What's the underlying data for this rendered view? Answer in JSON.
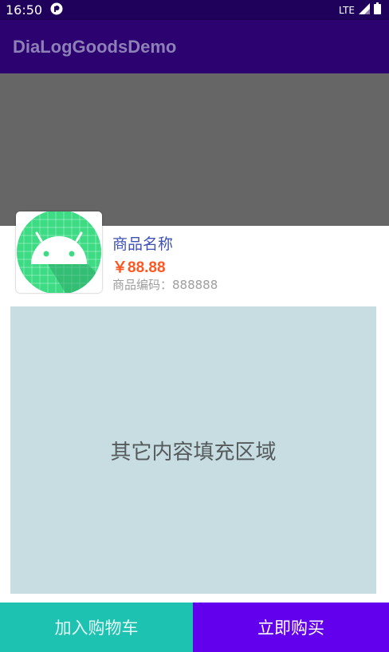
{
  "status_bar": {
    "time": "16:50",
    "network": "LTE"
  },
  "app_bar": {
    "title": "DiaLogGoodsDemo"
  },
  "goods": {
    "name": "商品名称",
    "price": "￥88.88",
    "code": "商品编码：888888"
  },
  "content": {
    "placeholder": "其它内容填充区域"
  },
  "actions": {
    "add_to_cart": "加入购物车",
    "buy_now": "立即购买"
  },
  "colors": {
    "status_bar": "#1f005a",
    "app_bar": "#2c0270",
    "scrim": "#666666",
    "fill_area": "#c7dde2",
    "cart_button": "#1dc2b1",
    "buy_button": "#6200ee",
    "price": "#ff5722",
    "name": "#3f51b5"
  },
  "icons": {
    "status_notification": "circle-notification-icon",
    "signal": "signal-icon",
    "battery": "battery-icon",
    "product": "android-icon"
  }
}
